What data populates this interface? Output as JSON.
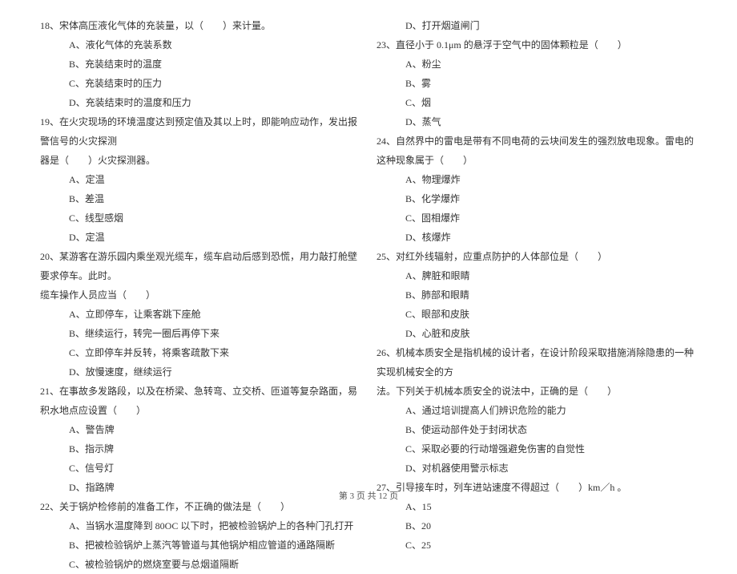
{
  "left": {
    "q18": {
      "text": "18、宋体高压液化气体的充装量，以（　　）来计量。",
      "A": "A、液化气体的充装系数",
      "B": "B、充装结束时的温度",
      "C": "C、充装结束时的压力",
      "D": "D、充装结束时的温度和压力"
    },
    "q19": {
      "line1": "19、在火灾现场的环境温度达到预定值及其以上时，即能响应动作，发出报警信号的火灾探测",
      "line2": "器是（　　）火灾探测器。",
      "A": "A、定温",
      "B": "B、差温",
      "C": "C、线型感烟",
      "D": "D、定温"
    },
    "q20": {
      "line1": "20、某游客在游乐园内乘坐观光缆车，缆车启动后感到恐慌，用力敲打舱壁要求停车。此时。",
      "line2": "缆车操作人员应当（　　）",
      "A": "A、立即停车，让乘客跳下座舱",
      "B": "B、继续运行，转完一圈后再停下来",
      "C": "C、立即停车并反转，将乘客疏散下来",
      "D": "D、放慢速度，继续运行"
    },
    "q21": {
      "text": "21、在事故多发路段，以及在桥梁、急转弯、立交桥、匝道等复杂路面，易积水地点应设置（　　）",
      "A": "A、警告牌",
      "B": "B、指示牌",
      "C": "C、信号灯",
      "D": "D、指路牌"
    },
    "q22": {
      "text": "22、关于锅炉检修前的准备工作，不正确的做法是（　　）",
      "A": "A、当锅水温度降到 80OC 以下时，把被检验锅炉上的各种门孔打开",
      "B": "B、把被检验锅炉上蒸汽等管道与其他锅炉相应管道的通路隔断",
      "C": "C、被检验锅炉的燃烧室要与总烟道隔断"
    }
  },
  "right": {
    "q22D": "D、打开烟道闸门",
    "q23": {
      "text": "23、直径小于 0.1μm 的悬浮于空气中的固体颗粒是（　　）",
      "A": "A、粉尘",
      "B": "B、雾",
      "C": "C、烟",
      "D": "D、蒸气"
    },
    "q24": {
      "text": "24、自然界中的雷电是带有不同电荷的云块间发生的强烈放电现象。雷电的这种现象属于（　　）",
      "A": "A、物理爆炸",
      "B": "B、化学爆炸",
      "C": "C、固相爆炸",
      "D": "D、核爆炸"
    },
    "q25": {
      "text": "25、对红外线辐射，应重点防护的人体部位是（　　）",
      "A": "A、脾脏和眼睛",
      "B": "B、肺部和眼睛",
      "C": "C、眼部和皮肤",
      "D": "D、心脏和皮肤"
    },
    "q26": {
      "line1": "26、机械本质安全是指机械的设计者，在设计阶段采取措施消除隐患的一种实现机械安全的方",
      "line2": "法。下列关于机械本质安全的说法中，正确的是（　　）",
      "A": "A、通过培训提高人们辨识危险的能力",
      "B": "B、使运动部件处于封闭状态",
      "C": "C、采取必要的行动增强避免伤害的自觉性",
      "D": "D、对机器使用警示标志"
    },
    "q27": {
      "text": "27、引导接车时，列车进站速度不得超过（　　）km／h 。",
      "A": "A、15",
      "B": "B、20",
      "C": "C、25"
    }
  },
  "footer": "第 3 页 共 12 页"
}
